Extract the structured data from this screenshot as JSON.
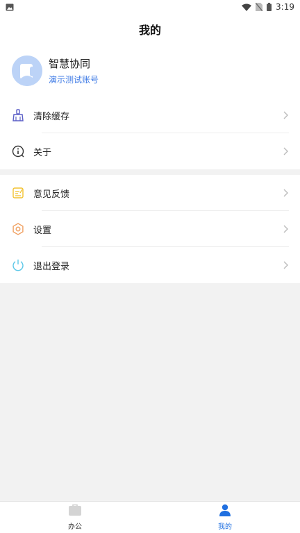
{
  "status_bar": {
    "time": "3:19",
    "icons": [
      "image-icon",
      "wifi-icon",
      "no-sim-icon",
      "battery-icon"
    ]
  },
  "header": {
    "title": "我的"
  },
  "profile": {
    "name": "智慧协同",
    "subtitle": "演示测试账号"
  },
  "menu_group_1": [
    {
      "label": "清除缓存",
      "icon": "broom-icon",
      "color": "#5b5fc7"
    },
    {
      "label": "关于",
      "icon": "info-icon",
      "color": "#333333"
    }
  ],
  "menu_group_2": [
    {
      "label": "意见反馈",
      "icon": "feedback-icon",
      "color": "#f2c230"
    },
    {
      "label": "设置",
      "icon": "settings-icon",
      "color": "#f0a060"
    },
    {
      "label": "退出登录",
      "icon": "power-icon",
      "color": "#5cc8e8"
    }
  ],
  "bottom_nav": {
    "tabs": [
      {
        "label": "办公",
        "icon": "briefcase-icon",
        "active": false
      },
      {
        "label": "我的",
        "icon": "user-icon",
        "active": true
      }
    ]
  },
  "colors": {
    "accent": "#1f6fe0",
    "background": "#f2f2f2"
  }
}
